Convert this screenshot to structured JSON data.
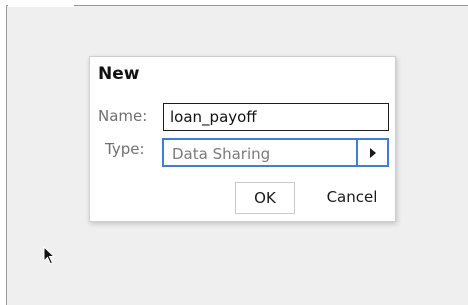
{
  "dialog": {
    "title": "New",
    "name_label": "Name:",
    "name_value": "loan_payoff",
    "type_label": "Type:",
    "type_value": "Data Sharing",
    "ok_label": "OK",
    "cancel_label": "Cancel"
  },
  "icons": {
    "dropdown_arrow": "triangle-right-icon",
    "cursor": "mouse-pointer-icon"
  },
  "colors": {
    "focus_border": "#3d7fd0",
    "background": "#efefef",
    "dialog_background": "#ffffff"
  }
}
